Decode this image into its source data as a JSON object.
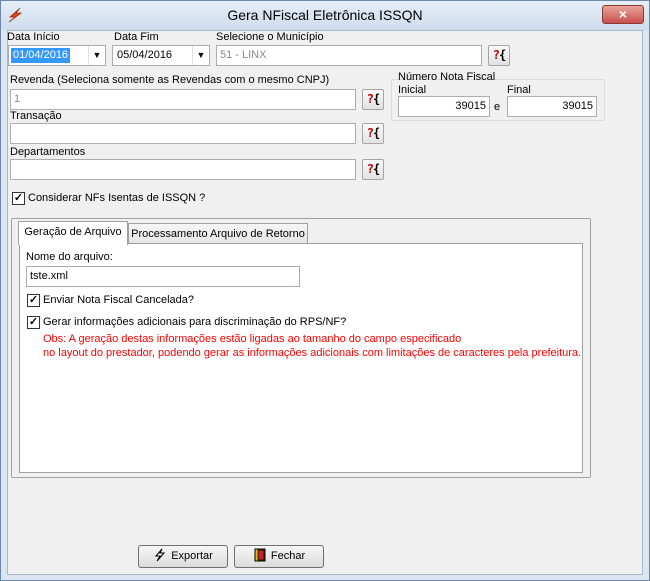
{
  "window": {
    "title": "Gera NFiscal Eletrônica ISSQN",
    "close_glyph": "×"
  },
  "form": {
    "data_inicio": {
      "label": "Data Início",
      "value": "01/04/2016"
    },
    "data_fim": {
      "label": "Data Fim",
      "value": "05/04/2016"
    },
    "municipio": {
      "label": "Selecione o Município",
      "value": "51 - LINX"
    },
    "revenda": {
      "label": "Revenda (Seleciona somente as Revendas com o mesmo CNPJ)",
      "value": "1"
    },
    "transacao": {
      "label": "Transação",
      "value": ""
    },
    "departamentos": {
      "label": "Departamentos",
      "value": ""
    },
    "lookup_glyph_q": "?",
    "lookup_glyph_b": "{",
    "numero_nota": {
      "label": "Número Nota Fiscal",
      "inicial_label": "Inicial",
      "inicial_value": "39015",
      "separator": "e",
      "final_label": "Final",
      "final_value": "39015"
    },
    "considerar_isentas": {
      "label": "Considerar NFs Isentas de ISSQN ?",
      "checked": true
    }
  },
  "tabs": [
    {
      "label": "Geração de Arquivo",
      "active": true
    },
    {
      "label": "Processamento Arquivo de Retorno",
      "active": false
    }
  ],
  "geracao": {
    "nome_arquivo_label": "Nome do arquivo:",
    "nome_arquivo_value": "tste.xml",
    "enviar_cancelada": {
      "label": "Enviar Nota Fiscal Cancelada?",
      "checked": true
    },
    "gerar_info": {
      "label": "Gerar informações adicionais para discriminação do RPS/NF?",
      "checked": true
    },
    "obs_line1": "Obs: A geração destas informações estão ligadas ao tamanho do campo especificado",
    "obs_line2": "no layout do prestador, podendo gerar as informações adicionais com limitações de caracteres pela prefeitura.",
    "obs_color": "#ff0000"
  },
  "buttons": {
    "exportar": "Exportar",
    "fechar": "Fechar"
  },
  "icons": {
    "app": "lightning-logo-icon",
    "exportar": "lightning-icon",
    "fechar": "exit-door-icon",
    "lookup": "lookup-icon",
    "dropdown": "chevron-down-icon"
  }
}
